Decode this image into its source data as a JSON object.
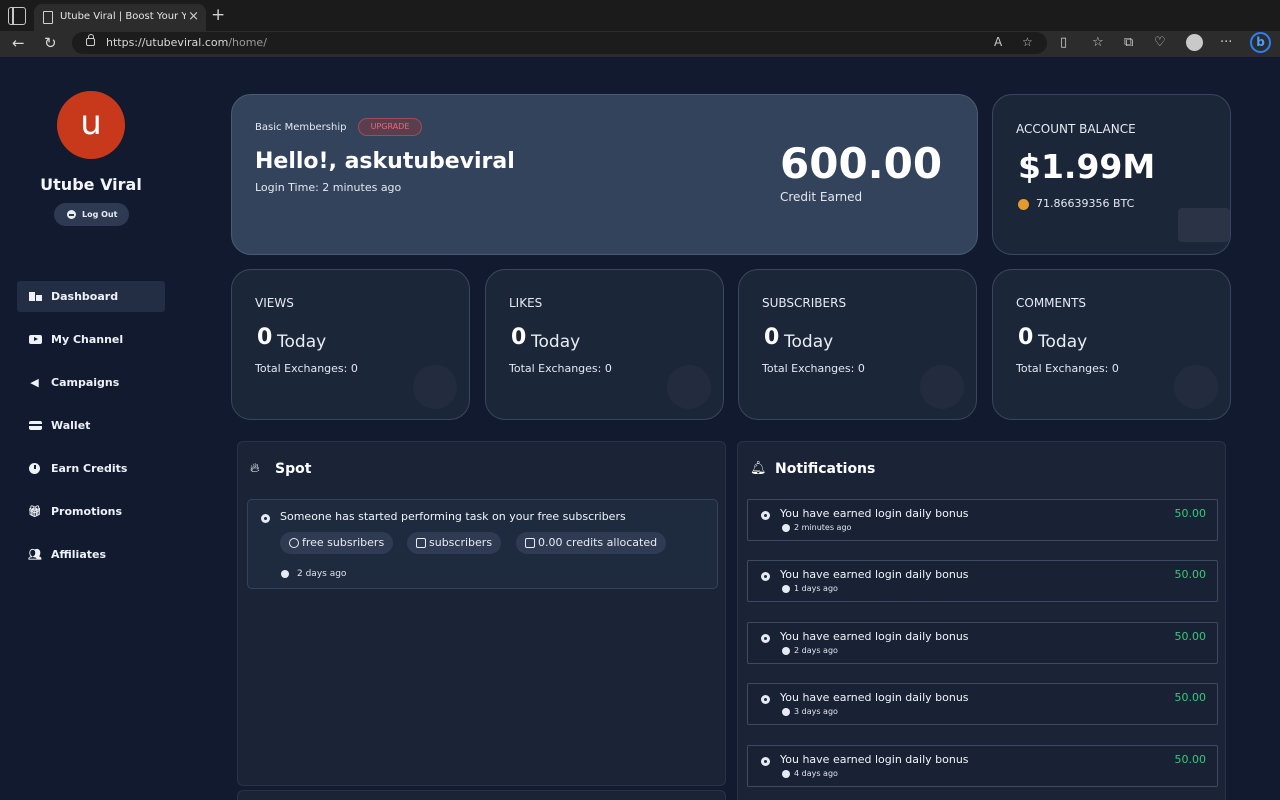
{
  "browser": {
    "tab_title": "Utube Viral | Boost Your Youtube",
    "url_host": "https://utubeviral.com",
    "url_path": "/home/"
  },
  "sidebar": {
    "avatar_letter": "u",
    "username": "Utube Viral",
    "logout_label": "Log Out",
    "items": [
      {
        "label": "Dashboard"
      },
      {
        "label": "My Channel"
      },
      {
        "label": "Campaigns"
      },
      {
        "label": "Wallet"
      },
      {
        "label": "Earn Credits"
      },
      {
        "label": "Promotions"
      },
      {
        "label": "Affiliates"
      }
    ]
  },
  "hero": {
    "membership": "Basic Membership",
    "upgrade_label": "UPGRADE",
    "greeting": "Hello!, askutubeviral",
    "login_time": "Login Time: 2 minutes ago",
    "credit_value": "600.00",
    "credit_label": "Credit Earned"
  },
  "balance": {
    "title": "ACCOUNT BALANCE",
    "value": "$1.99M",
    "btc": "71.86639356 BTC"
  },
  "stats": [
    {
      "title": "VIEWS",
      "count": "0",
      "today": "Today",
      "total": "Total Exchanges: 0"
    },
    {
      "title": "LIKES",
      "count": "0",
      "today": "Today",
      "total": "Total Exchanges: 0"
    },
    {
      "title": "SUBSCRIBERS",
      "count": "0",
      "today": "Today",
      "total": "Total Exchanges: 0"
    },
    {
      "title": "COMMENTS",
      "count": "0",
      "today": "Today",
      "total": "Total Exchanges: 0"
    }
  ],
  "spot": {
    "title": "Spot",
    "item": {
      "text": "Someone has started performing task on your free subscribers",
      "chips": [
        "free subsribers",
        "subscribers",
        "0.00 credits allocated"
      ],
      "time": "2 days ago"
    }
  },
  "notifications": {
    "title": "Notifications",
    "items": [
      {
        "text": "You have earned login daily bonus",
        "amount": "50.00",
        "time": "2 minutes ago"
      },
      {
        "text": "You have earned login daily bonus",
        "amount": "50.00",
        "time": "1 days ago"
      },
      {
        "text": "You have earned login daily bonus",
        "amount": "50.00",
        "time": "2 days ago"
      },
      {
        "text": "You have earned login daily bonus",
        "amount": "50.00",
        "time": "3 days ago"
      },
      {
        "text": "You have earned login daily bonus",
        "amount": "50.00",
        "time": "4 days ago"
      }
    ]
  }
}
